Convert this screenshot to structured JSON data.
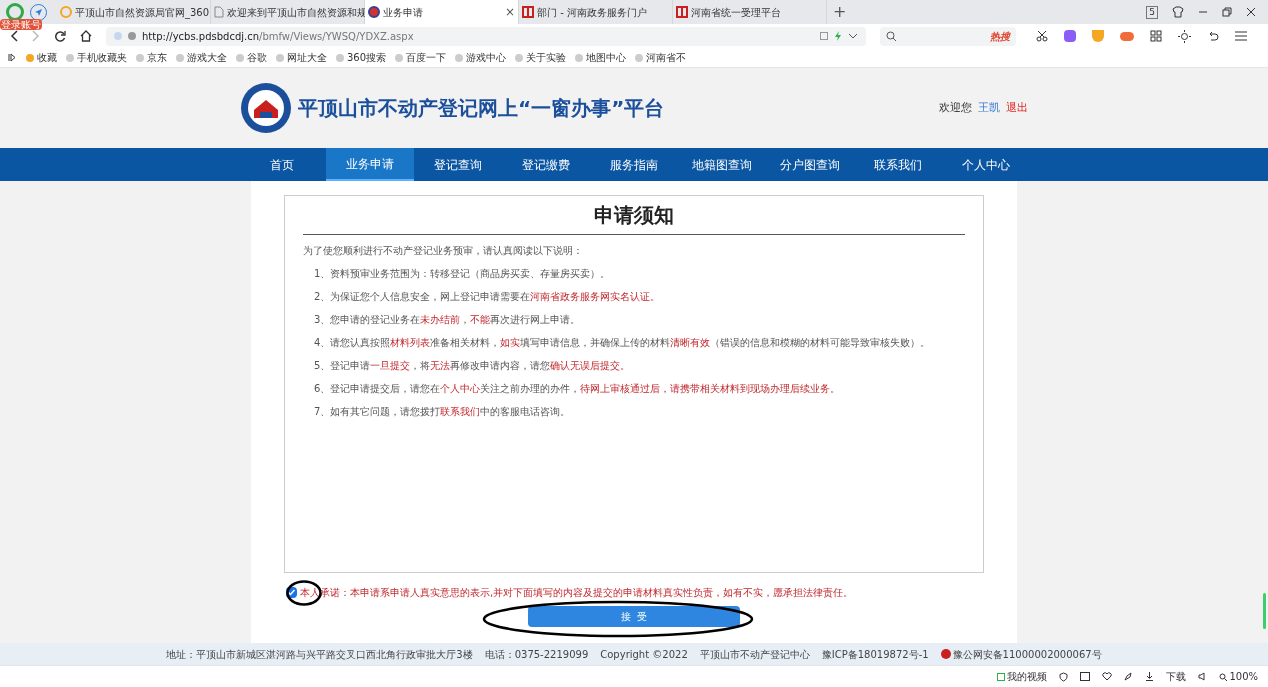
{
  "browser": {
    "badge": "登录账号",
    "tabs": [
      {
        "title": "平顶山市自然资源局官网_360",
        "selected": false
      },
      {
        "title": "欢迎来到平顶山市自然资源和规",
        "selected": false
      },
      {
        "title": "业务申请",
        "selected": true,
        "close": "×"
      },
      {
        "title": "部门 - 河南政务服务门户",
        "selected": false
      },
      {
        "title": "河南省统一受理平台",
        "selected": false
      }
    ],
    "new_tab": "+",
    "tab_count": "5",
    "url_host": "http://ycbs.pdsbdcdj.cn",
    "url_path": "/bmfw/Views/YWSQ/YDXZ.aspx",
    "search_hot": "热搜",
    "bookmarks": [
      "收藏",
      "手机收藏夹",
      "京东",
      "游戏大全",
      "谷歌",
      "网址大全",
      "360搜索",
      "百度一下",
      "游戏中心",
      "关于实验",
      "地图中心",
      "河南省不"
    ]
  },
  "header": {
    "title": "平顶山市不动产登记网上“一窗办事”平台",
    "welcome": "欢迎您",
    "user": "王凯",
    "logout": "退出"
  },
  "nav": [
    {
      "label": "首页",
      "selected": false
    },
    {
      "label": "业务申请",
      "selected": true
    },
    {
      "label": "登记查询",
      "selected": false
    },
    {
      "label": "登记缴费",
      "selected": false
    },
    {
      "label": "服务指南",
      "selected": false
    },
    {
      "label": "地籍图查询",
      "selected": false
    },
    {
      "label": "分户图查询",
      "selected": false
    },
    {
      "label": "联系我们",
      "selected": false
    },
    {
      "label": "个人中心",
      "selected": false
    }
  ],
  "notice": {
    "title": "申请须知",
    "intro": "为了使您顺利进行不动产登记业务预审，请认真阅读以下说明：",
    "items": [
      [
        {
          "t": "1、资料预审业务范围为：转移登记（商品房买卖、存量房买卖）。",
          "red": false
        }
      ],
      [
        {
          "t": "2、为保证您个人信息安全，网上登记申请需要在",
          "red": false
        },
        {
          "t": "河南省政务服务网实名认证。",
          "red": true
        }
      ],
      [
        {
          "t": "3、您申请的登记业务在",
          "red": false
        },
        {
          "t": "未办结前",
          "red": true
        },
        {
          "t": "，",
          "red": false
        },
        {
          "t": "不能",
          "red": true
        },
        {
          "t": "再次进行网上申请。",
          "red": false
        }
      ],
      [
        {
          "t": "4、请您认真按照",
          "red": false
        },
        {
          "t": "材料列表",
          "red": true
        },
        {
          "t": "准备相关材料，",
          "red": false
        },
        {
          "t": "如实",
          "red": true
        },
        {
          "t": "填写申请信息，并确保上传的材料",
          "red": false
        },
        {
          "t": "清晰有效",
          "red": true
        },
        {
          "t": "（错误的信息和模糊的材料可能导致审核失败）。",
          "red": false
        }
      ],
      [
        {
          "t": "5、登记申请",
          "red": false
        },
        {
          "t": "一旦提交",
          "red": true
        },
        {
          "t": "，将",
          "red": false
        },
        {
          "t": "无法",
          "red": true
        },
        {
          "t": "再修改申请内容，请您",
          "red": false
        },
        {
          "t": "确认无误后提交。",
          "red": true
        }
      ],
      [
        {
          "t": "6、登记申请提交后，请您在",
          "red": false
        },
        {
          "t": "个人中心",
          "red": true
        },
        {
          "t": "关注之前办理的办件，",
          "red": false
        },
        {
          "t": "待网上审核通过后，请携带相关材料到现场办理后续业务。",
          "red": true
        }
      ],
      [
        {
          "t": "7、如有其它问题，请您拨打",
          "red": false
        },
        {
          "t": "联系我们",
          "red": true
        },
        {
          "t": "中的客服电话咨询。",
          "red": false
        }
      ]
    ]
  },
  "pledge": {
    "checked": true,
    "text": "本人承诺：本申请系申请人真实意思的表示,并对下面填写的内容及提交的申请材料真实性负责，如有不实，愿承担法律责任。"
  },
  "accept_button": "接  受",
  "footer": {
    "address": "地址：平顶山市新城区湛河路与兴平路交叉口西北角行政审批大厅3楼",
    "phone": "电话：0375-2219099",
    "copyright": "Copyright ©2022",
    "org": "平顶山市不动产登记中心",
    "icp": "豫ICP备18019872号-1",
    "police": "豫公网安备11000002000067号"
  },
  "status_bar": {
    "video": "我的视频",
    "download": "下载",
    "zoom": "100%"
  }
}
